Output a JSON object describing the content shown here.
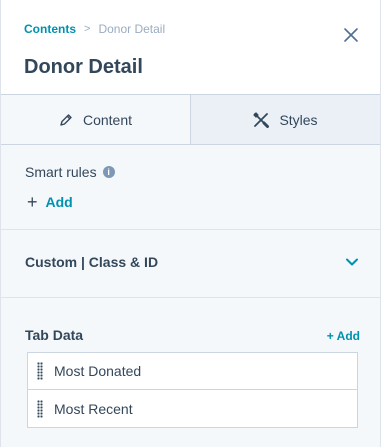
{
  "header": {
    "breadcrumb": {
      "parent": "Contents",
      "separator": ">",
      "current": "Donor Detail"
    },
    "title": "Donor Detail",
    "close_icon": "close-icon"
  },
  "tabs": [
    {
      "label": "Content",
      "icon": "pencil-icon",
      "active": true
    },
    {
      "label": "Styles",
      "icon": "paint-tools-icon",
      "active": false
    }
  ],
  "smart_rules": {
    "label": "Smart rules",
    "add_label": "Add"
  },
  "custom": {
    "label": "Custom | Class & ID"
  },
  "tab_data": {
    "label": "Tab Data",
    "add_label": "+ Add",
    "items": [
      "Most Donated",
      "Most Recent"
    ]
  },
  "colors": {
    "accent": "#0091ae",
    "text": "#33475b",
    "muted": "#99acc2",
    "border": "#cbd6e2",
    "panel_bg": "#f5f8fa"
  }
}
